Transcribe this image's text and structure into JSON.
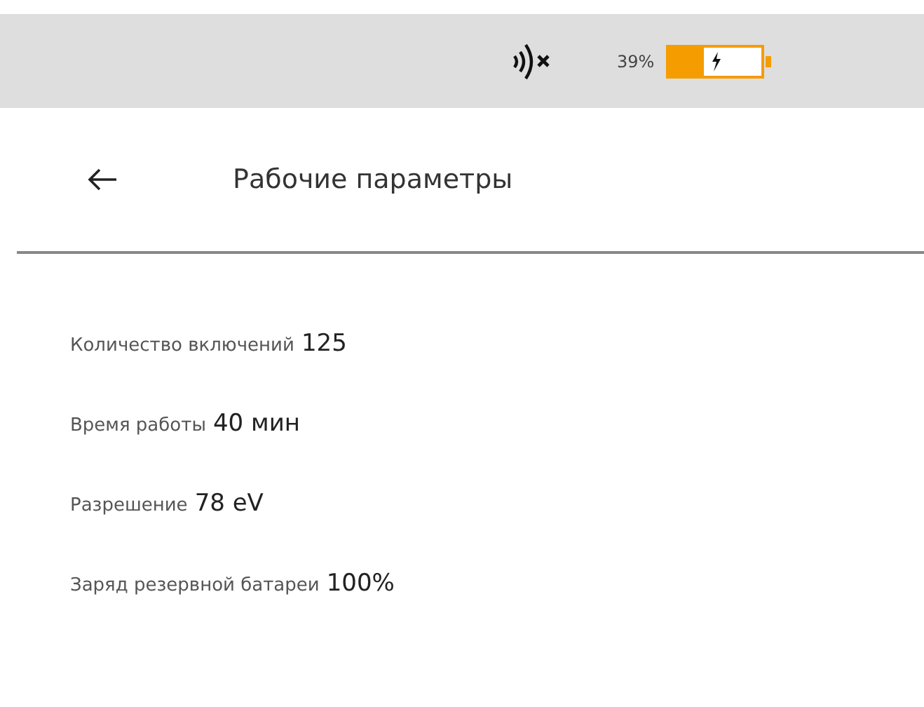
{
  "status_bar": {
    "nfc_off": true,
    "battery_text": "39%",
    "battery": {
      "level": 0.39,
      "charging": true
    }
  },
  "header": {
    "title": "Рабочие параметры"
  },
  "params": [
    {
      "label": "Количество включений",
      "value": "125"
    },
    {
      "label": "Время работы",
      "value": "40 мин"
    },
    {
      "label": "Разрешение",
      "value": "78 eV"
    },
    {
      "label": "Заряд резервной батареи",
      "value": "100%"
    }
  ]
}
